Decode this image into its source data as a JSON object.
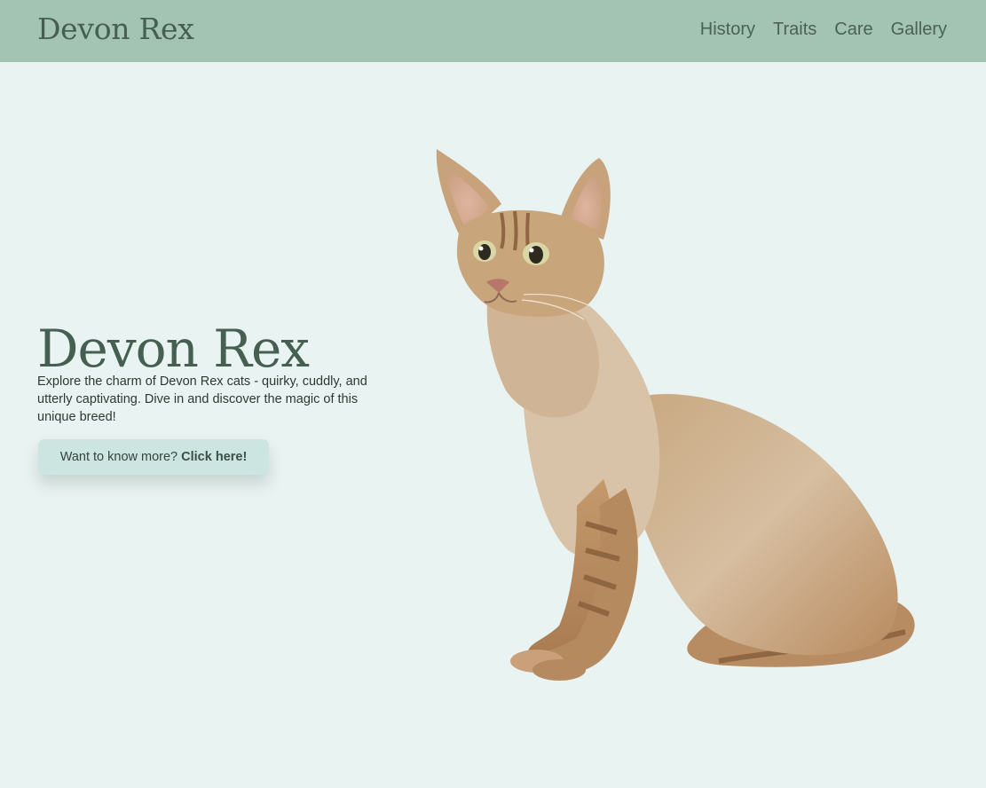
{
  "brand": {
    "title": "Devon Rex"
  },
  "nav": {
    "items": [
      "History",
      "Traits",
      "Care",
      "Gallery"
    ]
  },
  "hero": {
    "title": "Devon Rex",
    "description": "Explore the charm of Devon Rex cats - quirky, cuddly, and utterly captivating. Dive in and discover the magic of this unique breed!",
    "cta_prefix": "Want to know more? ",
    "cta_emphasis": "Click here!"
  },
  "colors": {
    "navbar_bg": "#a3c4b3",
    "page_bg": "#e9f3f1",
    "heading": "#455f52",
    "button_bg": "#cde5e0"
  },
  "icons": {
    "hero_image": "devon-rex-cat-photo"
  }
}
